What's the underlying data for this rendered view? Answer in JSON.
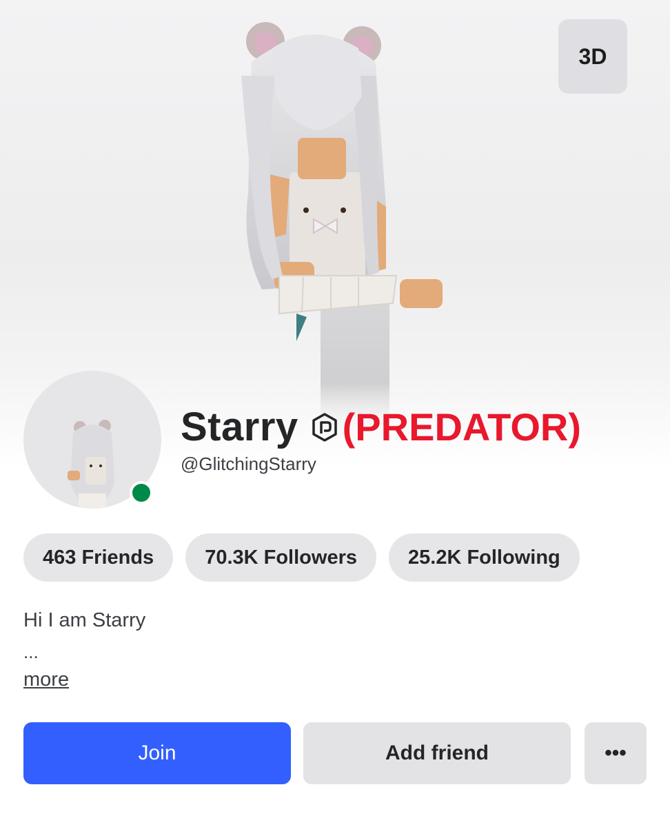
{
  "viewer": {
    "toggle_3d_label": "3D"
  },
  "profile": {
    "display_name": "Starry",
    "annotation": "(PREDATOR)",
    "username": "@GlitchingStarry",
    "online_status_color": "#008a4a",
    "verify_icon": "verified-badge-icon"
  },
  "stats": [
    {
      "label": "463 Friends"
    },
    {
      "label": "70.3K Followers"
    },
    {
      "label": "25.2K Following"
    }
  ],
  "bio": {
    "text": "Hi I am Starry",
    "ellipsis": "...",
    "more_label": "more"
  },
  "actions": {
    "join_label": "Join",
    "add_friend_label": "Add friend",
    "more_label": "•••"
  },
  "colors": {
    "accent": "#335fff",
    "annotation_red": "#e8182d",
    "pill_bg": "#e6e6e9"
  }
}
